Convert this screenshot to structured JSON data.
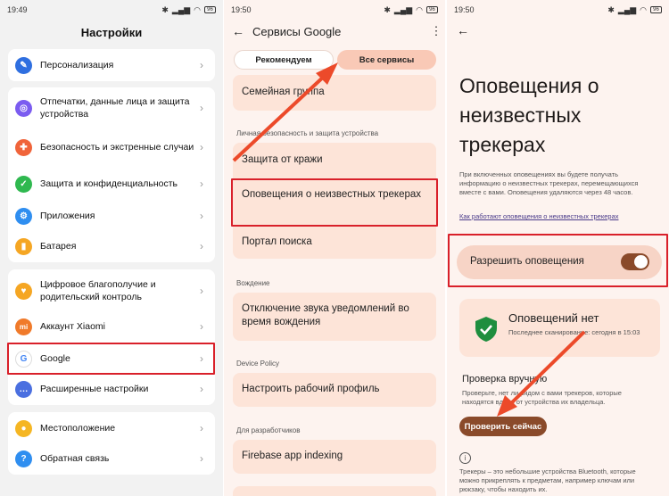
{
  "panels": [
    {
      "status": {
        "time": "19:49",
        "battery": "96"
      },
      "title": "Настройки",
      "items": [
        {
          "label": "Персонализация",
          "icon": "brush-icon",
          "color": "#2f6fe0"
        },
        {
          "label": "Отпечатки, данные лица и защита устройства",
          "icon": "fingerprint-icon",
          "color": "#7b5cf0"
        },
        {
          "label": "Безопасность и экстренные случаи",
          "icon": "emergency-icon",
          "color": "#f0643a"
        },
        {
          "label": "Защита и конфиденциальность",
          "icon": "shield-icon",
          "color": "#2fb84f"
        },
        {
          "label": "Приложения",
          "icon": "apps-icon",
          "color": "#2f8ef0"
        },
        {
          "label": "Батарея",
          "icon": "battery-icon",
          "color": "#f5a623"
        },
        {
          "label": "Цифровое благополучие и родительский контроль",
          "icon": "wellbeing-icon",
          "color": "#f5a623"
        },
        {
          "label": "Аккаунт Xiaomi",
          "icon": "xiaomi-icon",
          "color": "#f07a2a"
        },
        {
          "label": "Google",
          "icon": "google-icon",
          "color": "#ffffff"
        },
        {
          "label": "Расширенные настройки",
          "icon": "more-settings-icon",
          "color": "#4a6fe0"
        },
        {
          "label": "Местоположение",
          "icon": "location-icon",
          "color": "#f5b623"
        },
        {
          "label": "Обратная связь",
          "icon": "feedback-icon",
          "color": "#2f8ef0"
        }
      ]
    },
    {
      "status": {
        "time": "19:50",
        "battery": "96"
      },
      "title": "Сервисы Google",
      "tabs": [
        "Рекомендуем",
        "Все сервисы"
      ],
      "top_item": "Семейная группа",
      "section_privacy": "Личная безопасность и защита устройства",
      "privacy_items": [
        "Защита от кражи",
        "Оповещения о неизвестных трекерах",
        "Портал поиска"
      ],
      "section_driving": "Вождение",
      "driving_item": "Отключение звука уведомлений во время вождения",
      "section_device": "Device Policy",
      "device_item": "Настроить рабочий профиль",
      "section_dev": "Для разработчиков",
      "dev_item": "Firebase app indexing"
    },
    {
      "status": {
        "time": "19:50",
        "battery": "96"
      },
      "title": "Оповещения о неизвестных трекерах",
      "description": "При включенных оповещениях вы будете получать информацию о неизвестных трекерах, перемещающихся вместе с вами. Оповещения удаляются через 48 часов.",
      "link": "Как работают оповещения о неизвестных трекерах",
      "allow_label": "Разрешить оповещения",
      "allow_on": true,
      "no_alerts_title": "Оповещений нет",
      "last_scan": "Последнее сканирование: сегодня в 15:03",
      "manual_title": "Проверка вручную",
      "manual_desc": "Проверьте, нет ли рядом с вами трекеров, которые находятся вдали от устройства их владельца.",
      "check_button": "Проверить сейчас",
      "info_text": "Трекеры – это небольшие устройства Bluetooth, которые можно прикреплять к предметам, например ключам или рюкзаку, чтобы находить их."
    }
  ],
  "accent": {
    "highlight": "#d9202a",
    "arrow": "#ec4a2a",
    "toggle": "#8a4a2a"
  }
}
